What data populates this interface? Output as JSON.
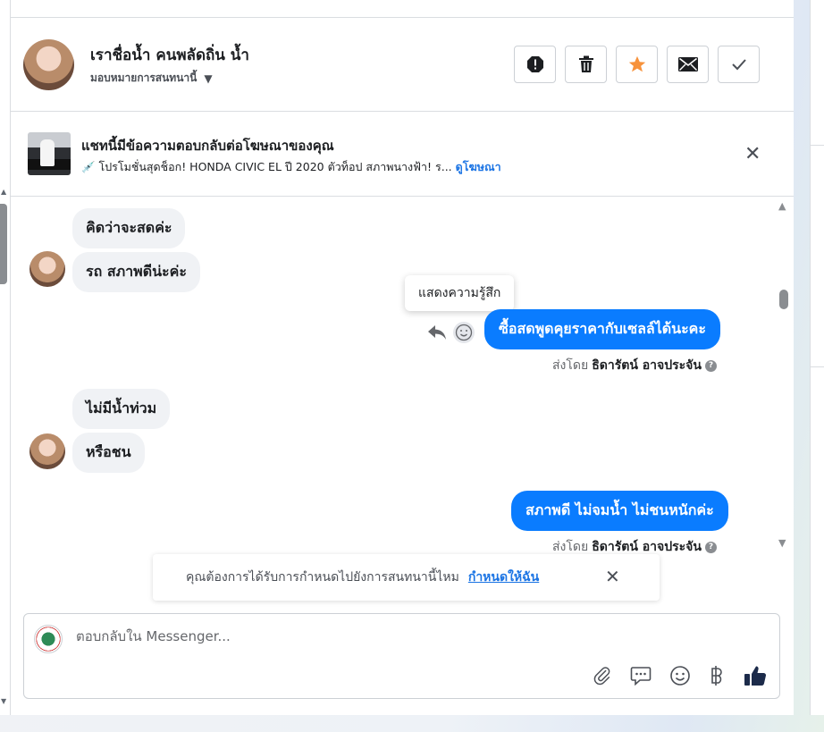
{
  "header": {
    "contact_name": "เราชื่อน้ำ คนพลัดถิ่น น้ำ",
    "assign_label": "มอบหมายการสนทนานี้",
    "actions": [
      {
        "name": "spam-icon"
      },
      {
        "name": "trash-icon"
      },
      {
        "name": "star-icon",
        "color": "#f7923b"
      },
      {
        "name": "envelope-icon"
      },
      {
        "name": "check-icon"
      }
    ]
  },
  "ad": {
    "title": "แชทนี้มีข้อความตอบกลับต่อโฆษณาของคุณ",
    "subtitle": "💉 โปรโมชั่นสุดช็อก! HONDA CIVIC EL ปี 2020 ตัวท็อป สภาพนางฟ้า! ร...",
    "view_ad_link": "ดูโฆษณา"
  },
  "messages": {
    "m1": "คิดว่าจะสดค่ะ",
    "m2": "รถ สภาพดีน่ะค่ะ",
    "tooltip": "แสดงความรู้สึก",
    "m3": "ซื้อสดพูดคุยราคากับเซลล์ได้นะคะ",
    "m4": "ไม่มีน้ำท่วม",
    "m5": "หรือชน",
    "m6": "สภาพดี ไม่จมน้ำ ไม่ชนหนักค่ะ",
    "sent_by_prefix": "ส่งโดย",
    "sent_by_name": "ธิดารัตน์ อาจประจัน",
    "help_glyph": "?"
  },
  "assign_prompt": {
    "text": "คุณต้องการได้รับการกำหนดไปยังการสนทนานี้ไหม",
    "link": "กำหนดให้ฉัน"
  },
  "composer": {
    "placeholder": "ตอบกลับใน Messenger...",
    "tools": [
      "paperclip-icon",
      "saved-replies-icon",
      "emoji-icon",
      "baht-icon",
      "thumbs-up-icon"
    ]
  },
  "colors": {
    "brand_blue": "#0a7cff",
    "link_blue": "#1b74e4",
    "star_orange": "#f7923b"
  }
}
